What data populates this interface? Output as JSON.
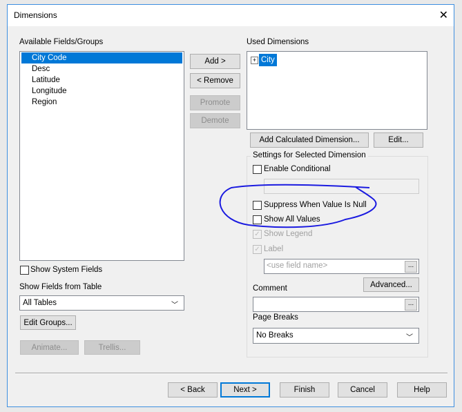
{
  "title": "Dimensions",
  "available": {
    "label": "Available Fields/Groups",
    "items": [
      "City Code",
      "Desc",
      "Latitude",
      "Longitude Region"
    ],
    "list": [
      "City Code",
      "Desc",
      "Latitude",
      "Longitude",
      "Region"
    ]
  },
  "buttons": {
    "add": "Add >",
    "remove": "< Remove",
    "promote": "Promote",
    "demote": "Demote",
    "add_calc": "Add Calculated Dimension...",
    "edit": "Edit...",
    "advanced": "Advanced...",
    "edit_groups": "Edit Groups...",
    "animate": "Animate...",
    "trellis": "Trellis...",
    "ellipsis": "...",
    "back": "< Back",
    "next": "Next >",
    "finish": "Finish",
    "cancel": "Cancel",
    "help": "Help"
  },
  "used": {
    "label": "Used Dimensions",
    "items": [
      "City"
    ]
  },
  "settings": {
    "title": "Settings for Selected Dimension",
    "enable_conditional": "Enable Conditional",
    "suppress_null": "Suppress When Value Is Null",
    "show_all_values": "Show All Values",
    "show_legend": "Show Legend",
    "label": "Label",
    "label_placeholder": "<use field name>",
    "comment": "Comment",
    "page_breaks": "Page Breaks",
    "page_breaks_value": "No Breaks"
  },
  "left": {
    "show_system_fields": "Show System Fields",
    "show_fields_from_table": "Show Fields from Table",
    "table_value": "All Tables"
  }
}
